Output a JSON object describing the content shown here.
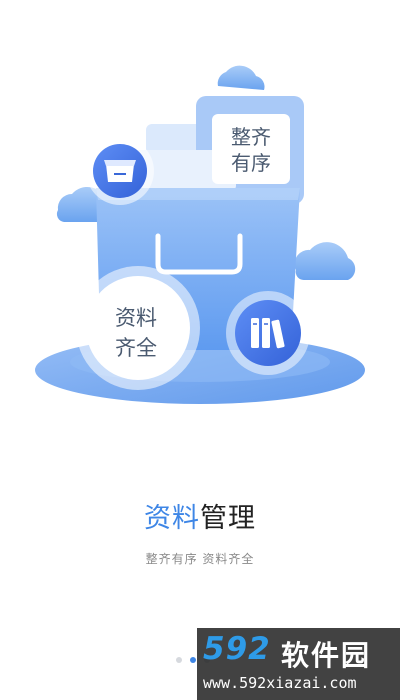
{
  "illustration": {
    "tag_top": [
      "整齐",
      "有序"
    ],
    "tag_circle": [
      "资料",
      "齐全"
    ]
  },
  "headline": {
    "accent": "资料",
    "rest": "管理"
  },
  "subtitle": "整齐有序 资料齐全",
  "pager": {
    "count": 3,
    "active_index": 1
  },
  "watermark": {
    "logo": "592",
    "brand": "软件园",
    "url": "www.592xiazai.com"
  },
  "colors": {
    "accent": "#3e86e6",
    "illustration_blue": "#6aa5f2",
    "text": "#222222"
  },
  "icons": [
    "cloud-icon",
    "inbox-icon",
    "books-icon"
  ]
}
